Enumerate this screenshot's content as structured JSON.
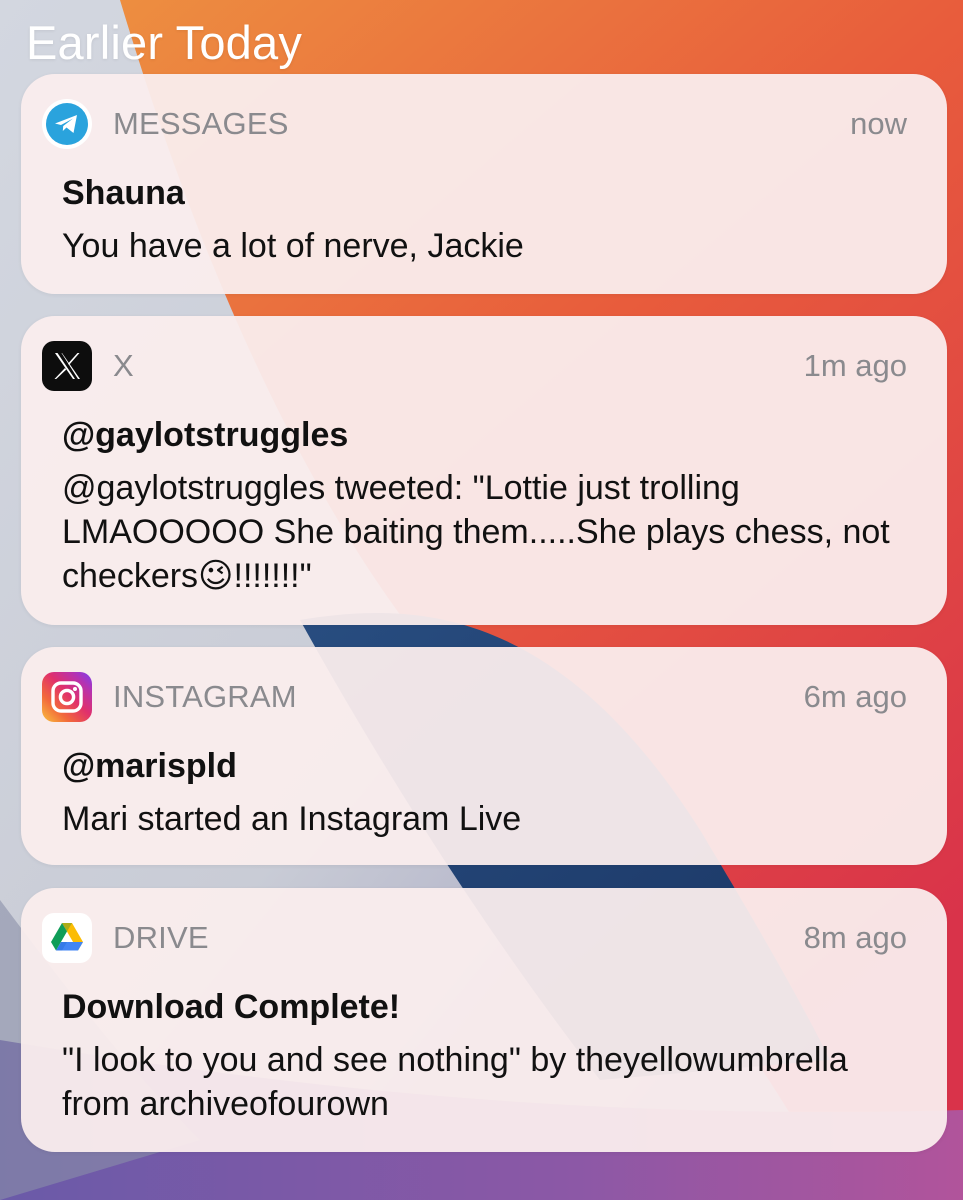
{
  "section": {
    "title": "Earlier Today"
  },
  "notifications": [
    {
      "app": "MESSAGES",
      "icon": "telegram-icon",
      "time": "now",
      "title": "Shauna",
      "body": "You have a lot of nerve, Jackie"
    },
    {
      "app": "X",
      "icon": "x-icon",
      "time": "1m ago",
      "title": "@gaylotstruggles",
      "body": "@gaylotstruggles tweeted: \"Lottie just trolling LMAOOOOO She baiting them.....She plays chess, not checkers😉!!!!!!!\""
    },
    {
      "app": "INSTAGRAM",
      "icon": "instagram-icon",
      "time": "6m ago",
      "title": "@marispld",
      "body": "Mari started an Instagram Live"
    },
    {
      "app": "DRIVE",
      "icon": "google-drive-icon",
      "time": "8m ago",
      "title": "Download Complete!",
      "body": "\"I look to you and see nothing\" by theyellowumbrella from archiveofourown"
    }
  ],
  "colors": {
    "card_background": "#faeded",
    "secondary_text": "#8a8a8e",
    "primary_text": "#111111",
    "telegram_blue": "#2aa3dd",
    "wallpaper_orange": "#ec7a3c",
    "wallpaper_red": "#dc3b40",
    "wallpaper_blue": "#1a3e73"
  }
}
